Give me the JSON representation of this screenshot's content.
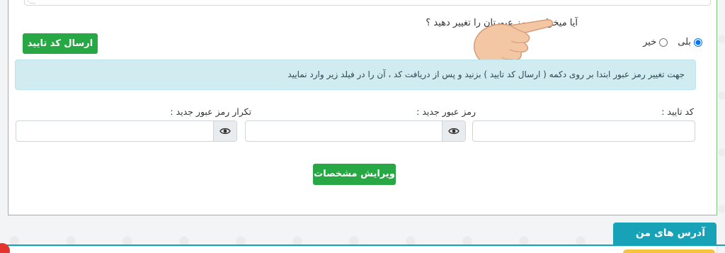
{
  "form": {
    "question": "آیا میخواهید رمز عبورتان را تغییر دهید ؟",
    "options": [
      {
        "label": "بلی",
        "checked": true
      },
      {
        "label": "خیر",
        "checked": false
      }
    ],
    "send_code_label": "ارسال کد تایید",
    "info_text": "جهت تغییر رمز عبور ابتدا بر روی دکمه ( ارسال کد تایید ) بزنید و پس از دریافت کد ، آن را در فیلد زیر وارد نمایید",
    "fields": {
      "code_label": "کد تایید :",
      "new_password_label": "رمز عبور جدید :",
      "repeat_password_label": "تکرار رمز عبور جدید :"
    },
    "submit_label": "ویرایش مشخصات"
  },
  "addresses": {
    "tab_label": "آدرس های من"
  },
  "colors": {
    "accent_green": "#28a745",
    "info_bg": "#d1ecf1",
    "tab_blue": "#17a2b8"
  }
}
